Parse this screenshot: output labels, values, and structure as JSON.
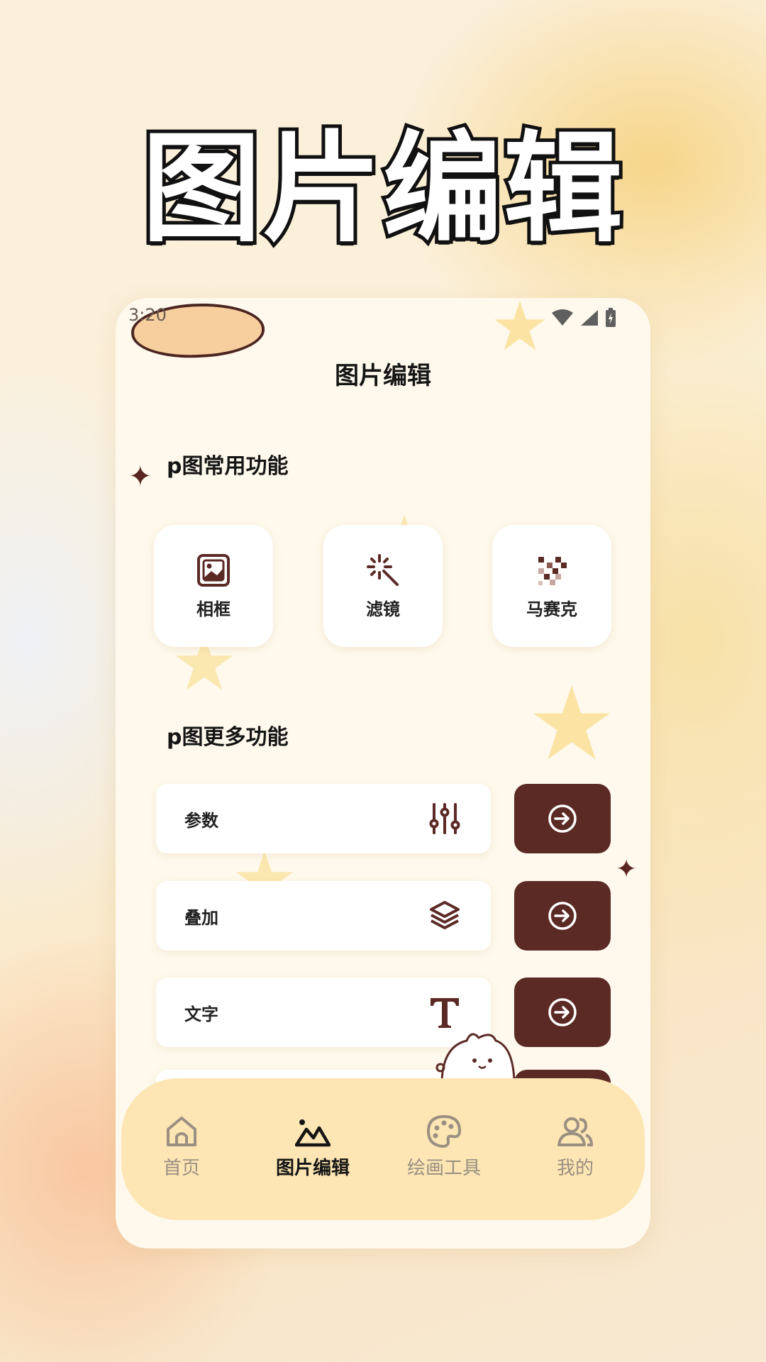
{
  "hero": {
    "title": "图片编辑"
  },
  "status": {
    "time": "3:20"
  },
  "header": {
    "title": "图片编辑"
  },
  "sections": {
    "common_title": "p图常用功能",
    "more_title": "p图更多功能"
  },
  "tools": [
    {
      "label": "相框",
      "icon": "photo-frame-icon"
    },
    {
      "label": "滤镜",
      "icon": "magic-wand-icon"
    },
    {
      "label": "马赛克",
      "icon": "mosaic-icon"
    }
  ],
  "more": [
    {
      "label": "参数",
      "icon": "sliders-icon"
    },
    {
      "label": "叠加",
      "icon": "layers-icon"
    },
    {
      "label": "文字",
      "icon": "text-icon"
    }
  ],
  "tabs": [
    {
      "label": "首页",
      "icon": "home-icon"
    },
    {
      "label": "图片编辑",
      "icon": "mountain-icon",
      "active": true
    },
    {
      "label": "绘画工具",
      "icon": "palette-icon"
    },
    {
      "label": "我的",
      "icon": "users-icon"
    }
  ],
  "colors": {
    "accent": "#5b2a25",
    "card": "#ffffff",
    "tab_bar": "#fde6b4",
    "phone_bg": "#fef9ec"
  }
}
